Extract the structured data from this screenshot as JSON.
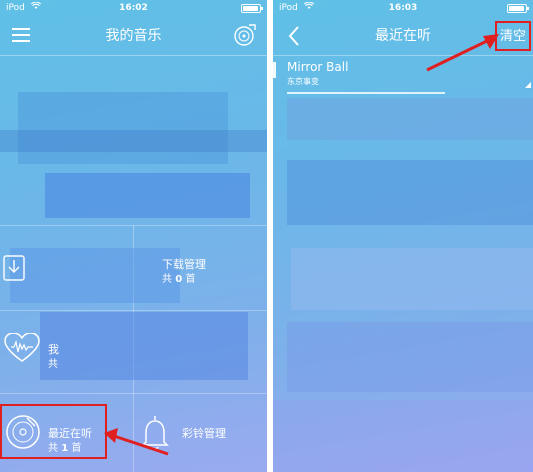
{
  "left_screen": {
    "status": {
      "carrier": "iPod",
      "time": "16:02"
    },
    "nav": {
      "title": "我的音乐"
    },
    "tiles": {
      "download": {
        "label": "下载管理",
        "count_prefix": "共",
        "count": "0",
        "count_suffix": "首"
      },
      "favorites": {
        "label": "我",
        "count_prefix": "共"
      },
      "recent": {
        "label": "最近在听",
        "count_prefix": "共",
        "count": "1",
        "count_suffix": "首"
      },
      "ringtone": {
        "label": "彩铃管理"
      }
    }
  },
  "right_screen": {
    "status": {
      "carrier": "iPod",
      "time": "16:03"
    },
    "nav": {
      "title": "最近在听",
      "clear_label": "清空"
    },
    "song": {
      "title": "Mirror Ball",
      "artist": "东京事变"
    }
  },
  "icons": {
    "menu": "menu-icon",
    "disc": "disc-icon",
    "back": "back-icon",
    "wifi": "wifi-icon",
    "battery": "battery-icon",
    "download": "download-icon",
    "heart": "heart-icon",
    "vinyl": "vinyl-icon",
    "bell": "bell-icon"
  },
  "colors": {
    "annotation_red": "#e02020",
    "background_top": "#5fc0e6",
    "background_bottom": "#9aaaf0"
  }
}
